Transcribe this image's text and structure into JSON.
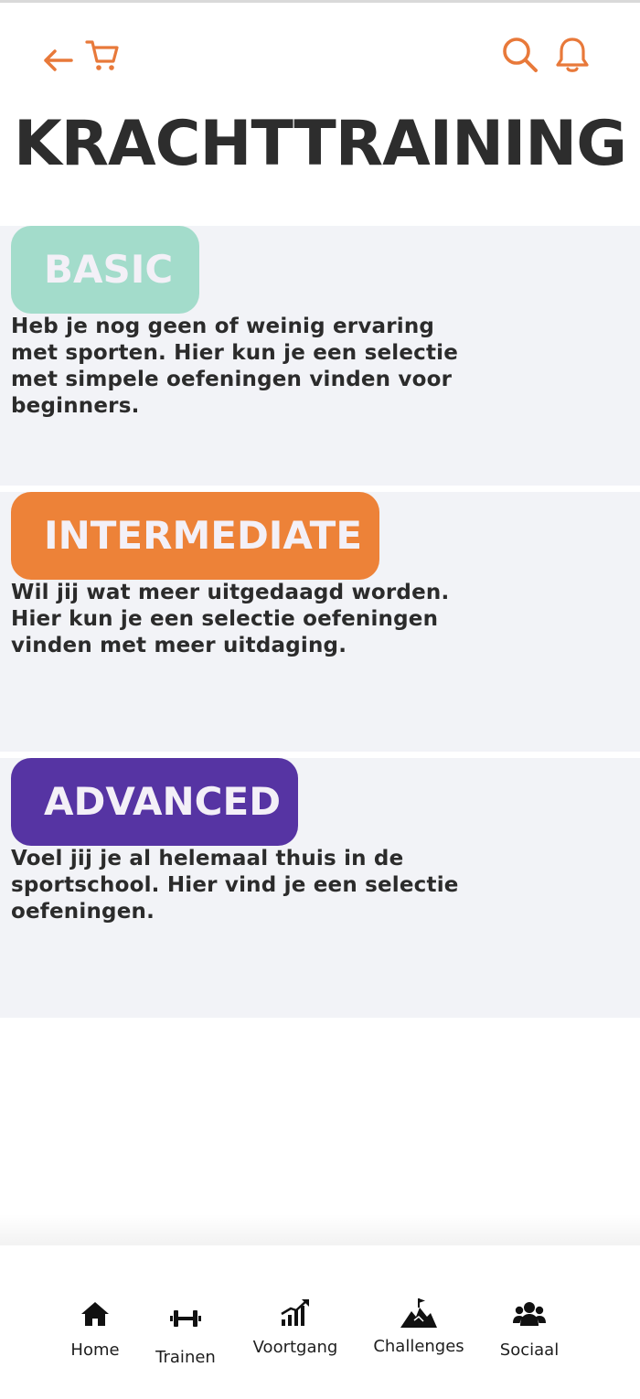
{
  "header": {
    "back_icon": "arrow-left-icon",
    "cart_icon": "cart-icon",
    "search_icon": "search-icon",
    "bell_icon": "bell-icon",
    "accent_color": "#e8793a"
  },
  "page": {
    "title": "KRACHTTRAINING"
  },
  "levels": [
    {
      "label": "BASIC",
      "color": "#a3dccb",
      "description": "Heb je nog geen of weinig ervaring met sporten. Hier kun je een selectie met simpele oefeningen vinden voor beginners."
    },
    {
      "label": "INTERMEDIATE",
      "color": "#ed8238",
      "description": "Wil jij wat meer uitgedaagd worden. Hier kun je een selectie oefeningen vinden met meer uitdaging."
    },
    {
      "label": "ADVANCED",
      "color": "#5634a3",
      "description": "Voel jij je al helemaal thuis in de sportschool. Hier vind je een selectie oefeningen."
    }
  ],
  "nav": {
    "items": [
      {
        "label": "Home",
        "icon": "home-icon"
      },
      {
        "label": "Trainen",
        "icon": "dumbbell-icon"
      },
      {
        "label": "Voortgang",
        "icon": "progress-chart-icon"
      },
      {
        "label": "Challenges",
        "icon": "mountain-flag-icon"
      },
      {
        "label": "Sociaal",
        "icon": "users-icon"
      }
    ]
  }
}
